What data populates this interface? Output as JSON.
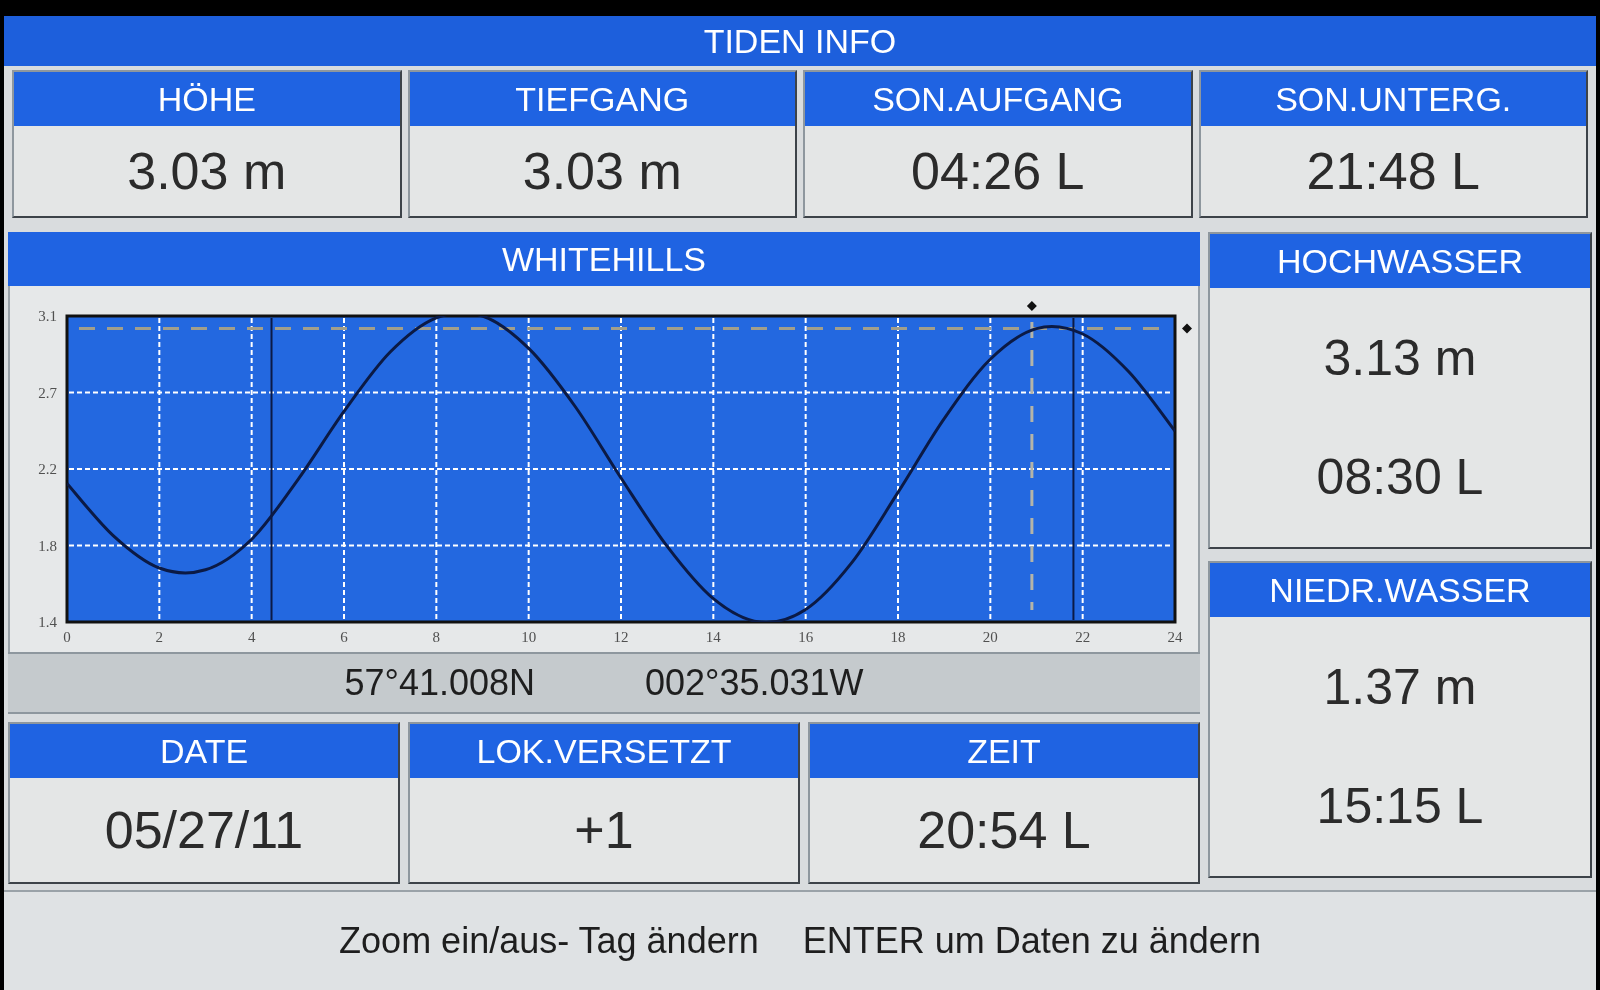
{
  "window": {
    "title": "TIDEN INFO"
  },
  "top_cards": [
    {
      "label": "HÖHE",
      "value": "3.03 m"
    },
    {
      "label": "TIEFGANG",
      "value": "3.03 m"
    },
    {
      "label": "SON.AUFGANG",
      "value": "04:26 L"
    },
    {
      "label": "SON.UNTERG.",
      "value": "21:48 L"
    }
  ],
  "station": {
    "name": "WHITEHILLS",
    "chart_data": {
      "type": "line",
      "x": [
        0,
        1,
        2,
        3,
        4,
        5,
        6,
        7,
        8,
        9,
        10,
        11,
        12,
        13,
        14,
        15,
        16,
        17,
        18,
        19,
        20,
        21,
        22,
        23,
        24
      ],
      "series": [
        {
          "color": "#0b1a45",
          "values": [
            2.17,
            1.88,
            1.7,
            1.69,
            1.86,
            2.19,
            2.57,
            2.9,
            3.09,
            3.1,
            2.92,
            2.6,
            2.2,
            1.82,
            1.53,
            1.4,
            1.47,
            1.73,
            2.12,
            2.53,
            2.86,
            3.03,
            3.0,
            2.79,
            2.46
          ]
        }
      ],
      "xlim": [
        0,
        24
      ],
      "ylim": [
        1.4,
        3.1
      ],
      "xticks": [
        0,
        2,
        4,
        6,
        8,
        10,
        12,
        14,
        16,
        18,
        20,
        22,
        24
      ],
      "yticks": [
        {
          "value": 1.4,
          "label": "1.4"
        },
        {
          "value": 1.825,
          "label": "1.8"
        },
        {
          "value": 2.25,
          "label": "2.2"
        },
        {
          "value": 2.675,
          "label": "2.7"
        },
        {
          "value": 3.1,
          "label": "3.1"
        }
      ],
      "grid": true,
      "ref_lines": [
        {
          "axis": "y",
          "value": 3.03,
          "color": "#a29f8c"
        },
        {
          "axis": "x",
          "value": 4.43,
          "color": "#0b1a45"
        },
        {
          "axis": "x",
          "value": 20.9,
          "color": "#b4b4a8"
        },
        {
          "axis": "x",
          "value": 21.8,
          "color": "#0b1a45"
        }
      ]
    },
    "position": {
      "latitude": "57°41.008N",
      "longitude": "002°35.031W"
    }
  },
  "high_water": {
    "label": "HOCHWASSER",
    "height": "3.13 m",
    "time": "08:30 L"
  },
  "low_water": {
    "label": "NIEDR.WASSER",
    "height": "1.37 m",
    "time": "15:15 L"
  },
  "bottom_cards": [
    {
      "label": "DATE",
      "value": "05/27/11"
    },
    {
      "label": "LOK.VERSETZT",
      "value": "+1"
    },
    {
      "label": "ZEIT",
      "value": "20:54 L"
    }
  ],
  "status_bar": {
    "hints": [
      "Zoom ein/aus- Tag ändern",
      "ENTER um Daten zu ändern"
    ]
  }
}
